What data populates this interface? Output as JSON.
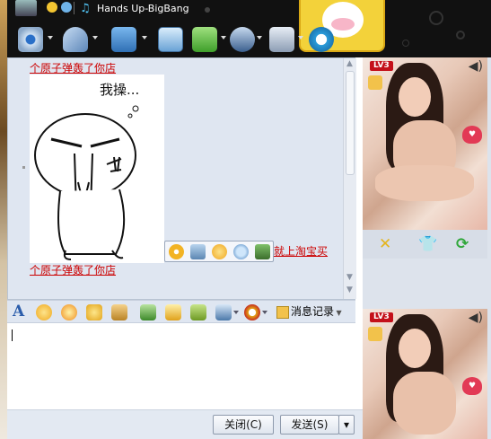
{
  "window": {
    "title": "Hands Up-BigBang"
  },
  "toolbar": {
    "items": [
      {
        "icon": "webcam-icon",
        "has_menu": true
      },
      {
        "icon": "microphone-icon",
        "has_menu": true
      },
      {
        "icon": "folder-transfer-icon",
        "has_menu": true
      },
      {
        "icon": "screenshot-icon",
        "has_menu": false
      },
      {
        "icon": "add-app-icon",
        "has_menu": true
      },
      {
        "icon": "user-card-icon",
        "has_menu": true
      },
      {
        "icon": "settings-icon",
        "has_menu": true
      },
      {
        "icon": "shop-icon",
        "has_menu": false
      }
    ]
  },
  "chat": {
    "messages": [
      {
        "text": "个原子弹轰了你店"
      },
      {
        "sticker_caption": "我操...",
        "sticker_icon": "angry-face-sticker"
      },
      {
        "text": "个原子弹轰了你店"
      }
    ],
    "link_overlay": "就上淘宝买",
    "image_toolbar": [
      "add-favorite-icon",
      "save-icon",
      "emoticon-icon",
      "search-image-icon",
      "gallery-icon"
    ]
  },
  "format_bar": {
    "items": [
      "font-icon",
      "emoticon-icon",
      "magic-emoticon-icon",
      "nudge-icon",
      "hand-draw-icon",
      "image-icon",
      "music-icon",
      "gift-icon",
      "screen-capture-icon",
      "shop-icon"
    ],
    "history_label": "消息记录"
  },
  "actions": {
    "close": "关闭(C)",
    "send": "发送(S)"
  },
  "right_panel": {
    "level_badge": "LV3",
    "show_tools": [
      "cross-icon",
      "shirt-icon",
      "refresh-icon"
    ]
  },
  "colors": {
    "link": "#cc0000",
    "chat_bg": "#dfe6f1",
    "skin_bg": "#111111",
    "accent": "#f3d23a"
  }
}
